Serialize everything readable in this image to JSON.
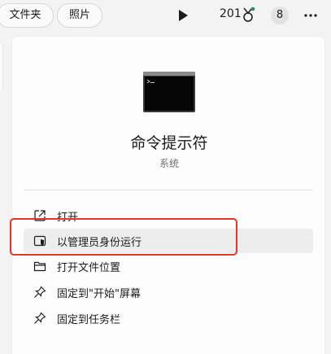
{
  "topbar": {
    "chip_folder": "文件夹",
    "chip_photos": "照片",
    "play_icon": "play-icon",
    "points": "201",
    "medal_icon": "rewards-medal-icon",
    "avatar_initial": "8",
    "more_icon": "more-horizontal-icon"
  },
  "app": {
    "title": "命令提示符",
    "subtitle": "系统",
    "icon": "command-prompt-icon"
  },
  "menu": {
    "items": [
      {
        "label": "打开",
        "icon": "open-external-icon"
      },
      {
        "label": "以管理员身份运行",
        "icon": "shield-admin-icon"
      },
      {
        "label": "打开文件位置",
        "icon": "folder-icon"
      },
      {
        "label": "固定到\"开始\"屏幕",
        "icon": "pin-icon"
      },
      {
        "label": "固定到任务栏",
        "icon": "pin-icon"
      }
    ]
  },
  "colors": {
    "highlight_border": "#e8352b",
    "hover_background": "#ededed"
  }
}
